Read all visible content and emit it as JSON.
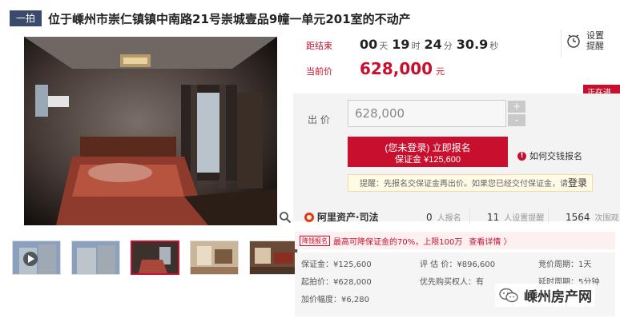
{
  "header": {
    "tag": "一拍",
    "title": "位于嵊州市崇仁镇镇中南路21号崇城壹品9幢一单元201室的不动产"
  },
  "countdown": {
    "label": "距结束",
    "days": "00",
    "days_unit": "天",
    "hours": "19",
    "hours_unit": "时",
    "minutes": "24",
    "minutes_unit": "分",
    "seconds": "30.9",
    "seconds_unit": "秒"
  },
  "current_price": {
    "label": "当前价",
    "value": "628,000",
    "unit": "元"
  },
  "remind": {
    "label": "设置提醒",
    "icon": "alarm-clock-icon"
  },
  "status_badge": "正在进行",
  "bid": {
    "label": "出 价",
    "value": "628,000",
    "plus": "+",
    "minus": "-",
    "register_line1": "(您未登录) 立即报名",
    "register_line2": "保证金 ¥125,600",
    "howto": "如何交钱报名",
    "tip": "提醒：先报名交保证金再出价。如果您已经交付保证金，请",
    "tip_login": "登录"
  },
  "platform": {
    "name": "阿里资产·司法",
    "signups_num": "0",
    "signups_label": "人报名",
    "reminders_num": "11",
    "reminders_label": "人设置提醒",
    "views_num": "1564",
    "views_label": "次围观"
  },
  "promo": {
    "tag": "降钱报名",
    "text": "最高可降保证金的70%，上限100万",
    "link": "查看详情 〉"
  },
  "info": {
    "deposit": "保证金：¥125,600",
    "start_price": "起拍价：¥628,000",
    "increment": "加价幅度：¥6,280",
    "appraisal": "评 估 价：¥896,600",
    "priority": "优先购买权人：有",
    "cycle": "竞价周期：1天",
    "delay": "延时周期：5分钟"
  },
  "watermark": {
    "text": "嵊州房产网",
    "icon": "wechat-icon"
  },
  "colors": {
    "accent": "#c8102e",
    "tag_bg": "#3a4a6c"
  }
}
